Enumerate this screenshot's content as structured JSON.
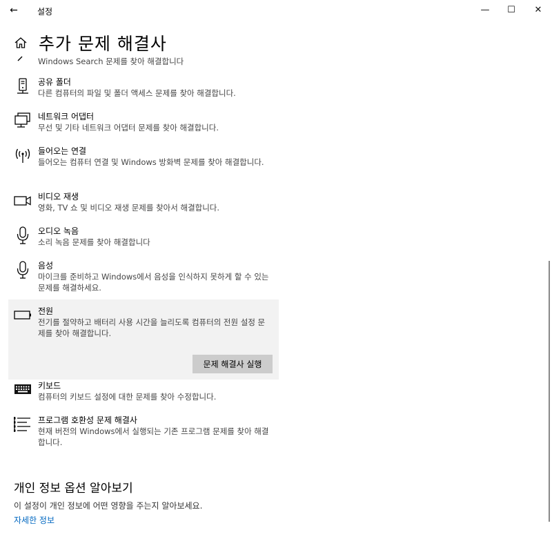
{
  "window": {
    "back_glyph": "←",
    "title": "설정",
    "minimize_glyph": "—",
    "maximize_glyph": "☐",
    "close_glyph": "✕"
  },
  "page": {
    "title": "추가 문제 해결사"
  },
  "items": [
    {
      "icon": "search-icon",
      "name": "",
      "desc": "Windows Search 문제를 찾아 해결합니다"
    },
    {
      "icon": "shared-folder-icon",
      "name": "공유 폴더",
      "desc": "다른 컴퓨터의 파일 및 폴더 액세스 문제를 찾아 해결합니다."
    },
    {
      "icon": "network-adapter-icon",
      "name": "네트워크 어댑터",
      "desc": "무선 및 기타 네트워크 어댑터 문제를 찾아 해결합니다."
    },
    {
      "icon": "incoming-connections-icon",
      "name": "들어오는 연결",
      "desc": "들어오는 컴퓨터 연결 및 Windows 방화벽 문제를 찾아 해결합니다."
    },
    {
      "icon": "video-camera-icon",
      "name": "비디오 재생",
      "desc": "영화, TV 쇼 및 비디오 재생 문제를 찾아서 해결합니다."
    },
    {
      "icon": "microphone-icon",
      "name": "오디오 녹음",
      "desc": "소리 녹음 문제를 찾아 해결합니다"
    },
    {
      "icon": "speech-microphone-icon",
      "name": "음성",
      "desc": "마이크를 준비하고 Windows에서 음성을 인식하지 못하게 할 수 있는 문제를 해결하세요."
    },
    {
      "icon": "battery-icon",
      "name": "전원",
      "desc": "전기를 절약하고 배터리 사용 시간을 늘리도록 컴퓨터의 전원 설정 문제를 찾아 해결합니다.",
      "button": "문제 해결사 실행"
    },
    {
      "icon": "keyboard-icon",
      "name": "키보드",
      "desc": "컴퓨터의 키보드 설정에 대한 문제를 찾아 수정합니다."
    },
    {
      "icon": "program-compatibility-icon",
      "name": "프로그램 호환성 문제 해결사",
      "desc": "현재 버전의 Windows에서 실행되는 기존 프로그램 문제를 찾아 해결합니다."
    }
  ],
  "privacy": {
    "title": "개인 정보 옵션 알아보기",
    "desc": "이 설정이 개인 정보에 어떤 영향을 주는지 알아보세요.",
    "link": "자세한 정보"
  },
  "colors": {
    "link": "#0067c0",
    "selected_bg": "#f2f2f2",
    "button_bg": "#cccccc"
  }
}
